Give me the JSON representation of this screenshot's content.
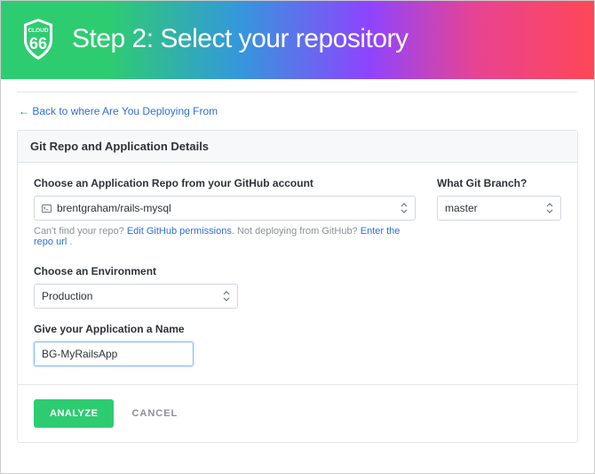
{
  "header": {
    "title": "Step 2: Select your repository",
    "logo_text_top": "CLOUD",
    "logo_text_num": "66"
  },
  "back_link": "← Back to where Are You Deploying From",
  "panel": {
    "title": "Git Repo and Application Details",
    "repo": {
      "label": "Choose an Application Repo from your GitHub account",
      "value": "brentgraham/rails-mysql",
      "helper_prefix": "Can't find your repo? ",
      "helper_link1": "Edit GitHub permissions",
      "helper_mid": ". Not deploying from GitHub? ",
      "helper_link2": "Enter the repo url",
      "helper_suffix": " ."
    },
    "branch": {
      "label": "What Git Branch?",
      "value": "master"
    },
    "environment": {
      "label": "Choose an Environment",
      "value": "Production"
    },
    "app_name": {
      "label": "Give your Application a Name",
      "value": "BG-MyRailsApp"
    },
    "actions": {
      "analyze": "ANALYZE",
      "cancel": "CANCEL"
    }
  }
}
